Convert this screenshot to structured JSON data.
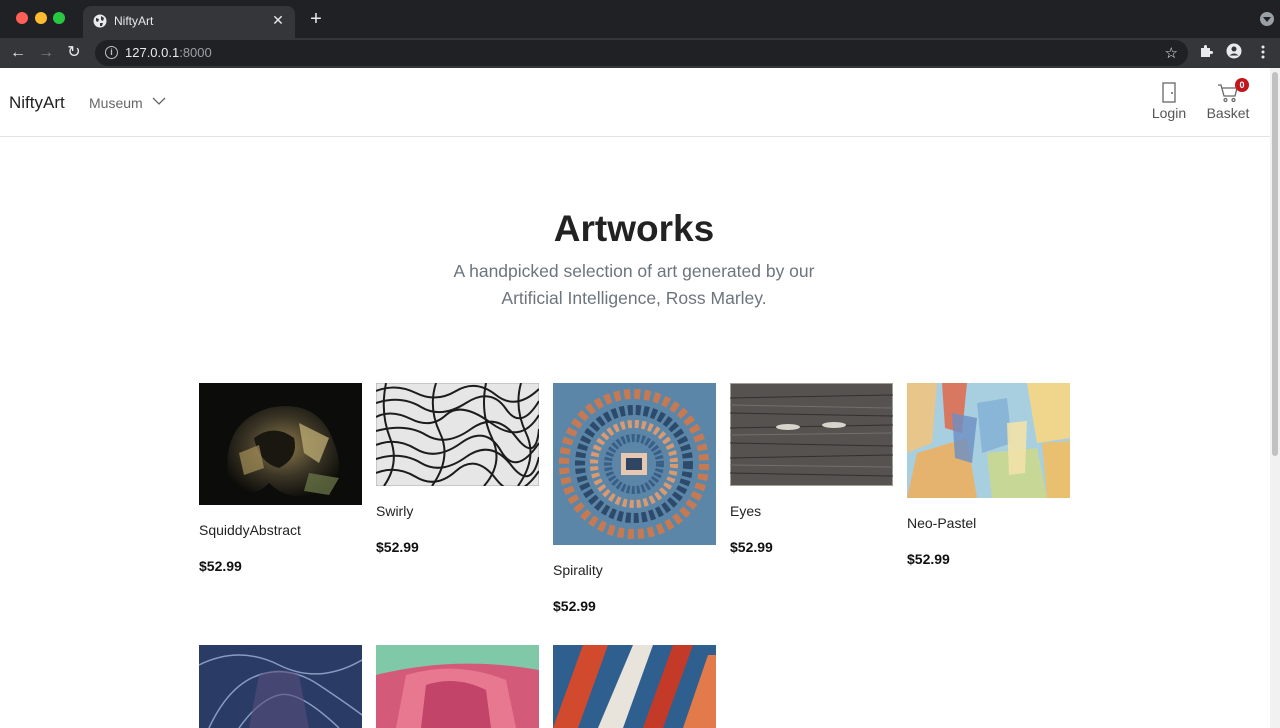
{
  "browser": {
    "tab_title": "NiftyArt",
    "url_host": "127.0.0.1",
    "url_port": ":8000"
  },
  "header": {
    "brand": "NiftyArt",
    "menu_label": "Museum",
    "login_label": "Login",
    "basket_label": "Basket",
    "basket_count": "0"
  },
  "hero": {
    "title": "Artworks",
    "subtitle": "A handpicked selection of art generated by our Artificial Intelligence, Ross Marley."
  },
  "artworks": [
    {
      "name": "SquiddyAbstract",
      "price": "$52.99"
    },
    {
      "name": "Swirly",
      "price": "$52.99"
    },
    {
      "name": "Spirality",
      "price": "$52.99"
    },
    {
      "name": "Eyes",
      "price": "$52.99"
    },
    {
      "name": "Neo-Pastel",
      "price": "$52.99"
    }
  ],
  "colors": {
    "badge": "#c0161c",
    "chrome_dark": "#202124",
    "chrome_toolbar": "#35363a"
  }
}
